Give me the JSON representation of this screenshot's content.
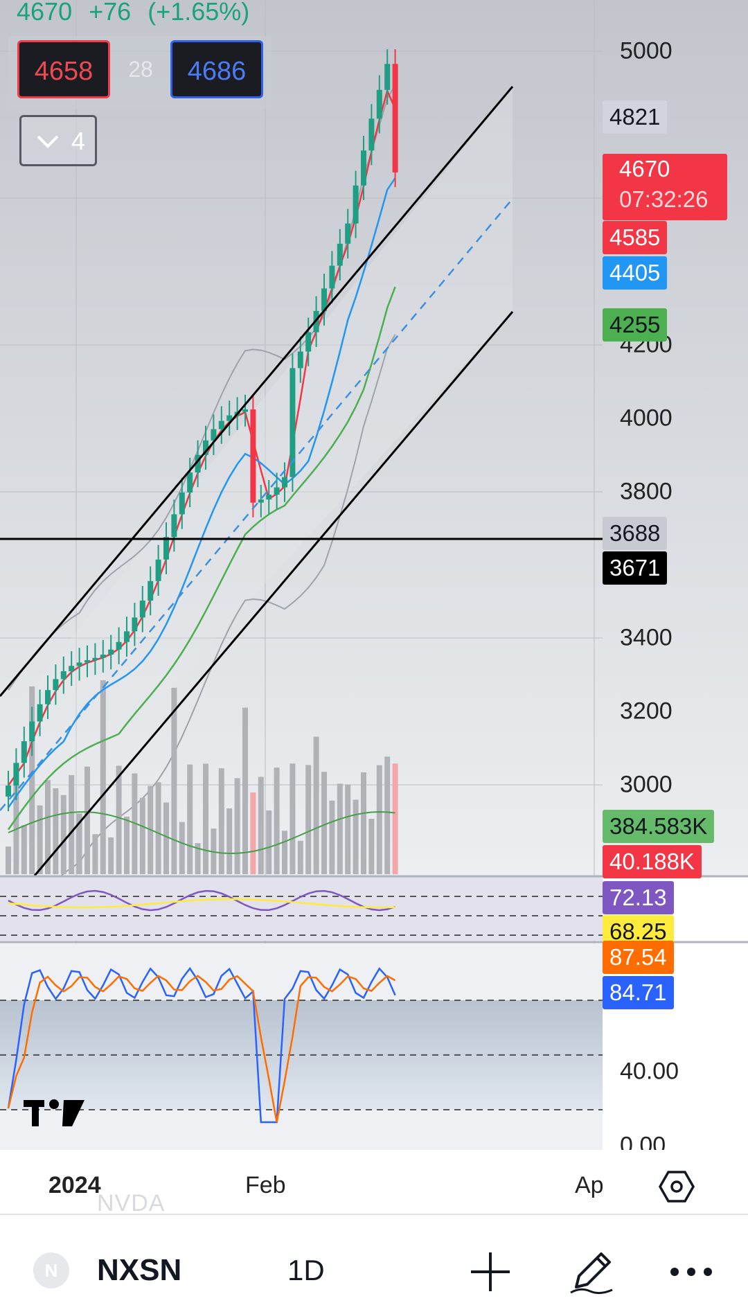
{
  "quote": {
    "last": "4670",
    "change": "+76",
    "change_pct": "(+1.65%)"
  },
  "order_panel": {
    "sell_price": "4658",
    "spread": "28",
    "buy_price": "4686"
  },
  "indicators_toggle": {
    "count": "4"
  },
  "price_axis": {
    "ticks": [
      "5000",
      "4200",
      "4000",
      "3800",
      "3400",
      "3200",
      "3000",
      "40.00",
      "0.00"
    ]
  },
  "badges": {
    "high_level": "4821",
    "last_price": "4670",
    "countdown": "07:32:26",
    "ma_red": "4585",
    "ma_blue": "4405",
    "ma_green": "4255",
    "level_line": "3688",
    "crosshair": "3671",
    "volume_ma": "384.583K",
    "volume": "40.188K",
    "rsi": "72.13",
    "rsi_ma": "68.25",
    "stoch_d": "87.54",
    "stoch_k": "84.71"
  },
  "time_axis": {
    "labels": [
      "2024",
      "Feb",
      "Ap"
    ]
  },
  "bottom_bar": {
    "ghost_symbol": "NVDA",
    "symbol_initial": "N",
    "symbol": "NXSN",
    "interval": "1D"
  },
  "colors": {
    "up": "#1f9e84",
    "down": "#f23645",
    "ma_red": "#f23645",
    "ma_blue": "#2196f3",
    "ma_green": "#4caf50",
    "rsi": "#7e57c2",
    "rsi_ma": "#ffeb3b",
    "stoch_k": "#2962ff",
    "stoch_d": "#ff6d00",
    "volume_ma": "#43a047"
  },
  "icons": [
    "chevron-down-icon",
    "tradingview-logo",
    "settings-hexagon-icon",
    "plus-icon",
    "pencil-draw-icon",
    "more-dots-icon"
  ]
}
